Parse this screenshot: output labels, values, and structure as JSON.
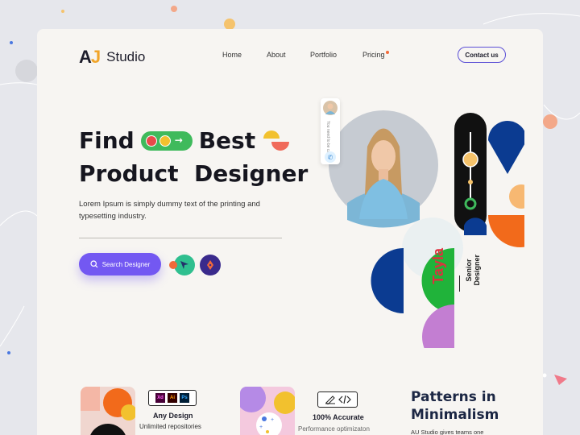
{
  "brand": {
    "logo_mark_a": "A",
    "logo_mark_j": "J",
    "name": "Studio"
  },
  "nav": {
    "items": [
      "Home",
      "About",
      "Portfolio",
      "Pricing"
    ],
    "contact_label": "Contact us"
  },
  "hero": {
    "title_word1": "Find",
    "title_word2": "Best",
    "title_line2": "Product  Designer",
    "subtitle": "Lorem Ipsum is simply dummy text of the printing and typesetting industry.",
    "search_label": "Search Designer",
    "tool_icons": [
      "cursor-icon",
      "pen-tool-icon"
    ]
  },
  "profile": {
    "chip_text": "You need to be call",
    "name": "Tayla",
    "role_line1": "Senior",
    "role_line2": "Designer"
  },
  "features": [
    {
      "title": "Any Design",
      "subtitle": "Unlimited repositories",
      "badges": [
        "Xd",
        "Ai",
        "Ps"
      ]
    },
    {
      "title": "100% Accurate",
      "subtitle": "Performance optimizaton",
      "badges": [
        "pencil-icon",
        "code-icon"
      ]
    }
  ],
  "patterns": {
    "title_line1": "Patterns in",
    "title_line2": "Minimalism",
    "subtitle": "AU Studio gives teams one"
  },
  "colors": {
    "accent_purple": "#7358f2",
    "green": "#3fba5c",
    "navy": "#0b3b91",
    "orange": "#f26a1b",
    "red": "#e0303e",
    "yellow": "#f2c12e"
  }
}
